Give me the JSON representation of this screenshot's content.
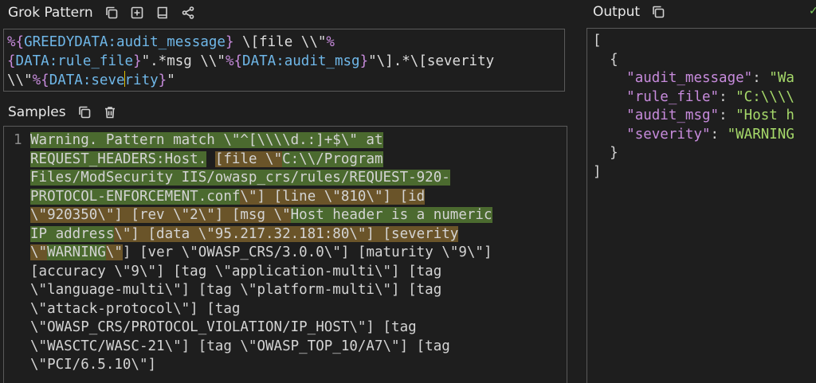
{
  "grok_panel": {
    "title": "Grok Pattern",
    "pattern_segments": [
      {
        "t": "syn",
        "v": "%{"
      },
      {
        "t": "name",
        "v": "GREEDYDATA:audit_message"
      },
      {
        "t": "syn",
        "v": "}"
      },
      {
        "t": "lit",
        "v": " \\[file \\\\\""
      },
      {
        "t": "syn",
        "v": "%"
      },
      {
        "t": "br"
      },
      {
        "t": "syn",
        "v": "{"
      },
      {
        "t": "name",
        "v": "DATA:rule_file"
      },
      {
        "t": "syn",
        "v": "}"
      },
      {
        "t": "lit",
        "v": "\".*msg \\\\\""
      },
      {
        "t": "syn",
        "v": "%{"
      },
      {
        "t": "name",
        "v": "DATA:audit_msg"
      },
      {
        "t": "syn",
        "v": "}"
      },
      {
        "t": "lit",
        "v": "\"\\].*\\[severity"
      },
      {
        "t": "br"
      },
      {
        "t": "lit",
        "v": "\\\\\""
      },
      {
        "t": "syn",
        "v": "%{"
      },
      {
        "t": "name",
        "v": "DATA:seve"
      },
      {
        "t": "caret"
      },
      {
        "t": "name",
        "v": "rity"
      },
      {
        "t": "syn",
        "v": "}"
      },
      {
        "t": "lit",
        "v": "\""
      }
    ]
  },
  "samples_panel": {
    "title": "Samples",
    "line_number": "1",
    "sample_segments": [
      {
        "h": "green",
        "v": "Warning. Pattern match \\\"^[\\\\\\\\d.:]+$\\\" at"
      },
      {
        "h": "br"
      },
      {
        "h": "green",
        "v": "REQUEST_HEADERS:Host."
      },
      {
        "h": "none",
        "v": " "
      },
      {
        "h": "brown",
        "v": "[file \\\""
      },
      {
        "h": "green",
        "v": "C:\\\\/Program"
      },
      {
        "h": "br"
      },
      {
        "h": "green",
        "v": "Files/ModSecurity IIS/owasp_crs/rules/REQUEST-920-"
      },
      {
        "h": "br"
      },
      {
        "h": "green",
        "v": "PROTOCOL-ENFORCEMENT.conf"
      },
      {
        "h": "brown",
        "v": "\\\"] [line \\\"810\\\"] [id"
      },
      {
        "h": "br"
      },
      {
        "h": "brown",
        "v": "\\\"920350\\\"] [rev \\\"2\\\"] [msg \\\""
      },
      {
        "h": "green",
        "v": "Host header is a numeric"
      },
      {
        "h": "br"
      },
      {
        "h": "green",
        "v": "IP address"
      },
      {
        "h": "brown",
        "v": "\\\"] [data \\\"95.217.32.181:80\\\"] [severity"
      },
      {
        "h": "br"
      },
      {
        "h": "brown",
        "v": "\\\""
      },
      {
        "h": "green",
        "v": "WARNING"
      },
      {
        "h": "brown",
        "v": "\\\""
      },
      {
        "h": "none",
        "v": "] [ver \\\"OWASP_CRS/3.0.0\\\"] [maturity \\\"9\\\"]"
      },
      {
        "h": "br"
      },
      {
        "h": "none",
        "v": "[accuracy \\\"9\\\"] [tag \\\"application-multi\\\"] [tag"
      },
      {
        "h": "br"
      },
      {
        "h": "none",
        "v": "\\\"language-multi\\\"] [tag \\\"platform-multi\\\"] [tag"
      },
      {
        "h": "br"
      },
      {
        "h": "none",
        "v": "\\\"attack-protocol\\\"] [tag"
      },
      {
        "h": "br"
      },
      {
        "h": "none",
        "v": "\\\"OWASP_CRS/PROTOCOL_VIOLATION/IP_HOST\\\"] [tag"
      },
      {
        "h": "br"
      },
      {
        "h": "none",
        "v": "\\\"WASCTC/WASC-21\\\"] [tag \\\"OWASP_TOP_10/A7\\\"] [tag"
      },
      {
        "h": "br"
      },
      {
        "h": "none",
        "v": "\\\"PCI/6.5.10\\\"]"
      }
    ]
  },
  "output_panel": {
    "title": "Output",
    "open_bracket": "[",
    "open_brace": "{",
    "fields": [
      {
        "key": "\"audit_message\"",
        "value": "\"Wa"
      },
      {
        "key": "\"rule_file\"",
        "value": "\"C:\\\\\\\\"
      },
      {
        "key": "\"audit_msg\"",
        "value": "\"Host h"
      },
      {
        "key": "\"severity\"",
        "value": "\"WARNING"
      }
    ],
    "close_brace": "}",
    "close_bracket": "]"
  },
  "icons": {
    "grok": [
      "copy-icon",
      "add-icon",
      "book-icon",
      "share-icon"
    ],
    "samples": [
      "copy-icon",
      "trash-icon"
    ],
    "output": [
      "copy-icon"
    ]
  },
  "colors": {
    "background": "#1e1e1e",
    "match_green": "#4b6a2f",
    "match_brown": "#6a5429",
    "syntax_purple": "#c78bdc",
    "syntax_blue": "#6fb7e8",
    "json_string": "#a6d96a"
  }
}
